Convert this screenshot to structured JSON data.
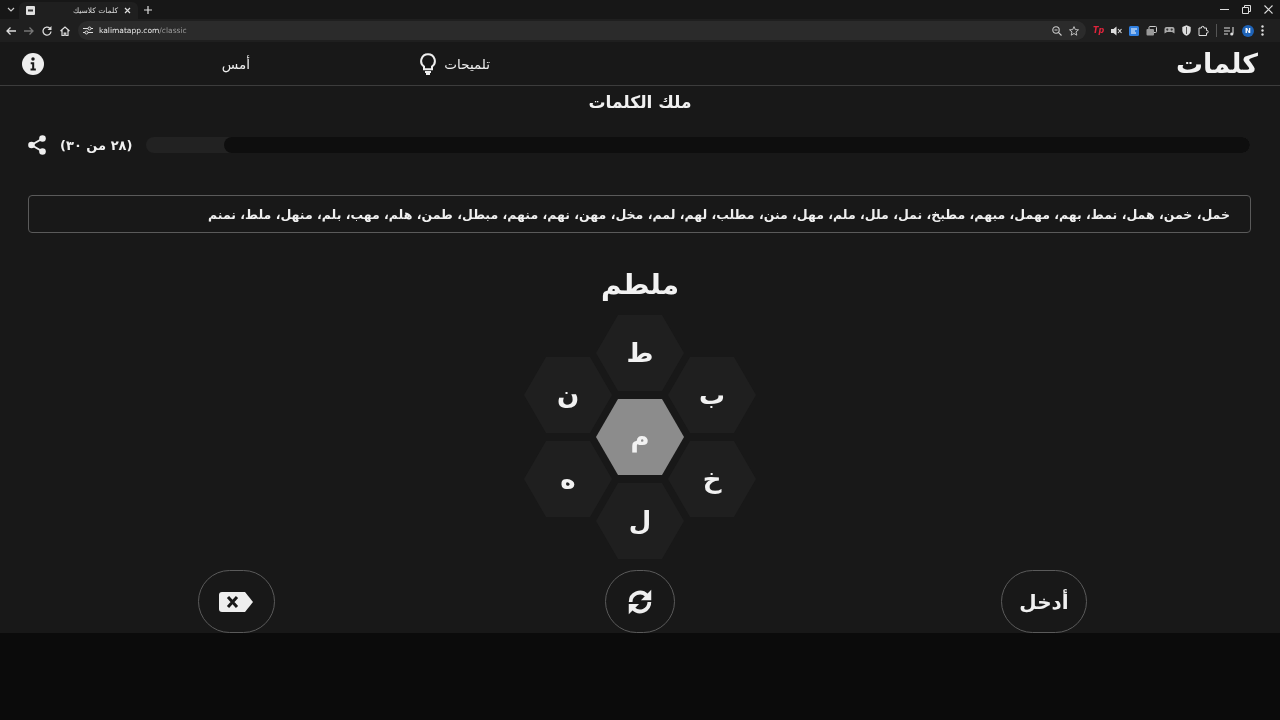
{
  "browser": {
    "tab": {
      "title": "كلمات كلاسيك"
    },
    "address": {
      "domain": "kalimatapp.com",
      "path": "/classic"
    },
    "extension_label": "Tp",
    "profile_initial": "N"
  },
  "header": {
    "logo": "كلمات",
    "hints": "تلميحات",
    "yesterday": "أمس"
  },
  "game": {
    "rank": "ملك الكلمات",
    "progress": {
      "label": "(٢٨ من ٣٠)",
      "level": 0.93
    },
    "found_words": "خمل، خمن، همل، نمط، بهم، مهمل، مبهم، مطبخ، نمل، ملل، ملم، مهل، منن، مطلب، لهم، لمم، مخل، مهن، نهم، منهم، مبطل، طمن، هلم، مهب، بلم، منهل، ملط، نمنم",
    "current_word": "ملطم",
    "center_letter": "م",
    "outer_letters": [
      "ط",
      "ب",
      "خ",
      "ل",
      "ه",
      "ن"
    ],
    "buttons": [
      {
        "kind": "enter",
        "label": "أدخل"
      },
      {
        "kind": "shuffle"
      },
      {
        "kind": "delete"
      }
    ]
  }
}
